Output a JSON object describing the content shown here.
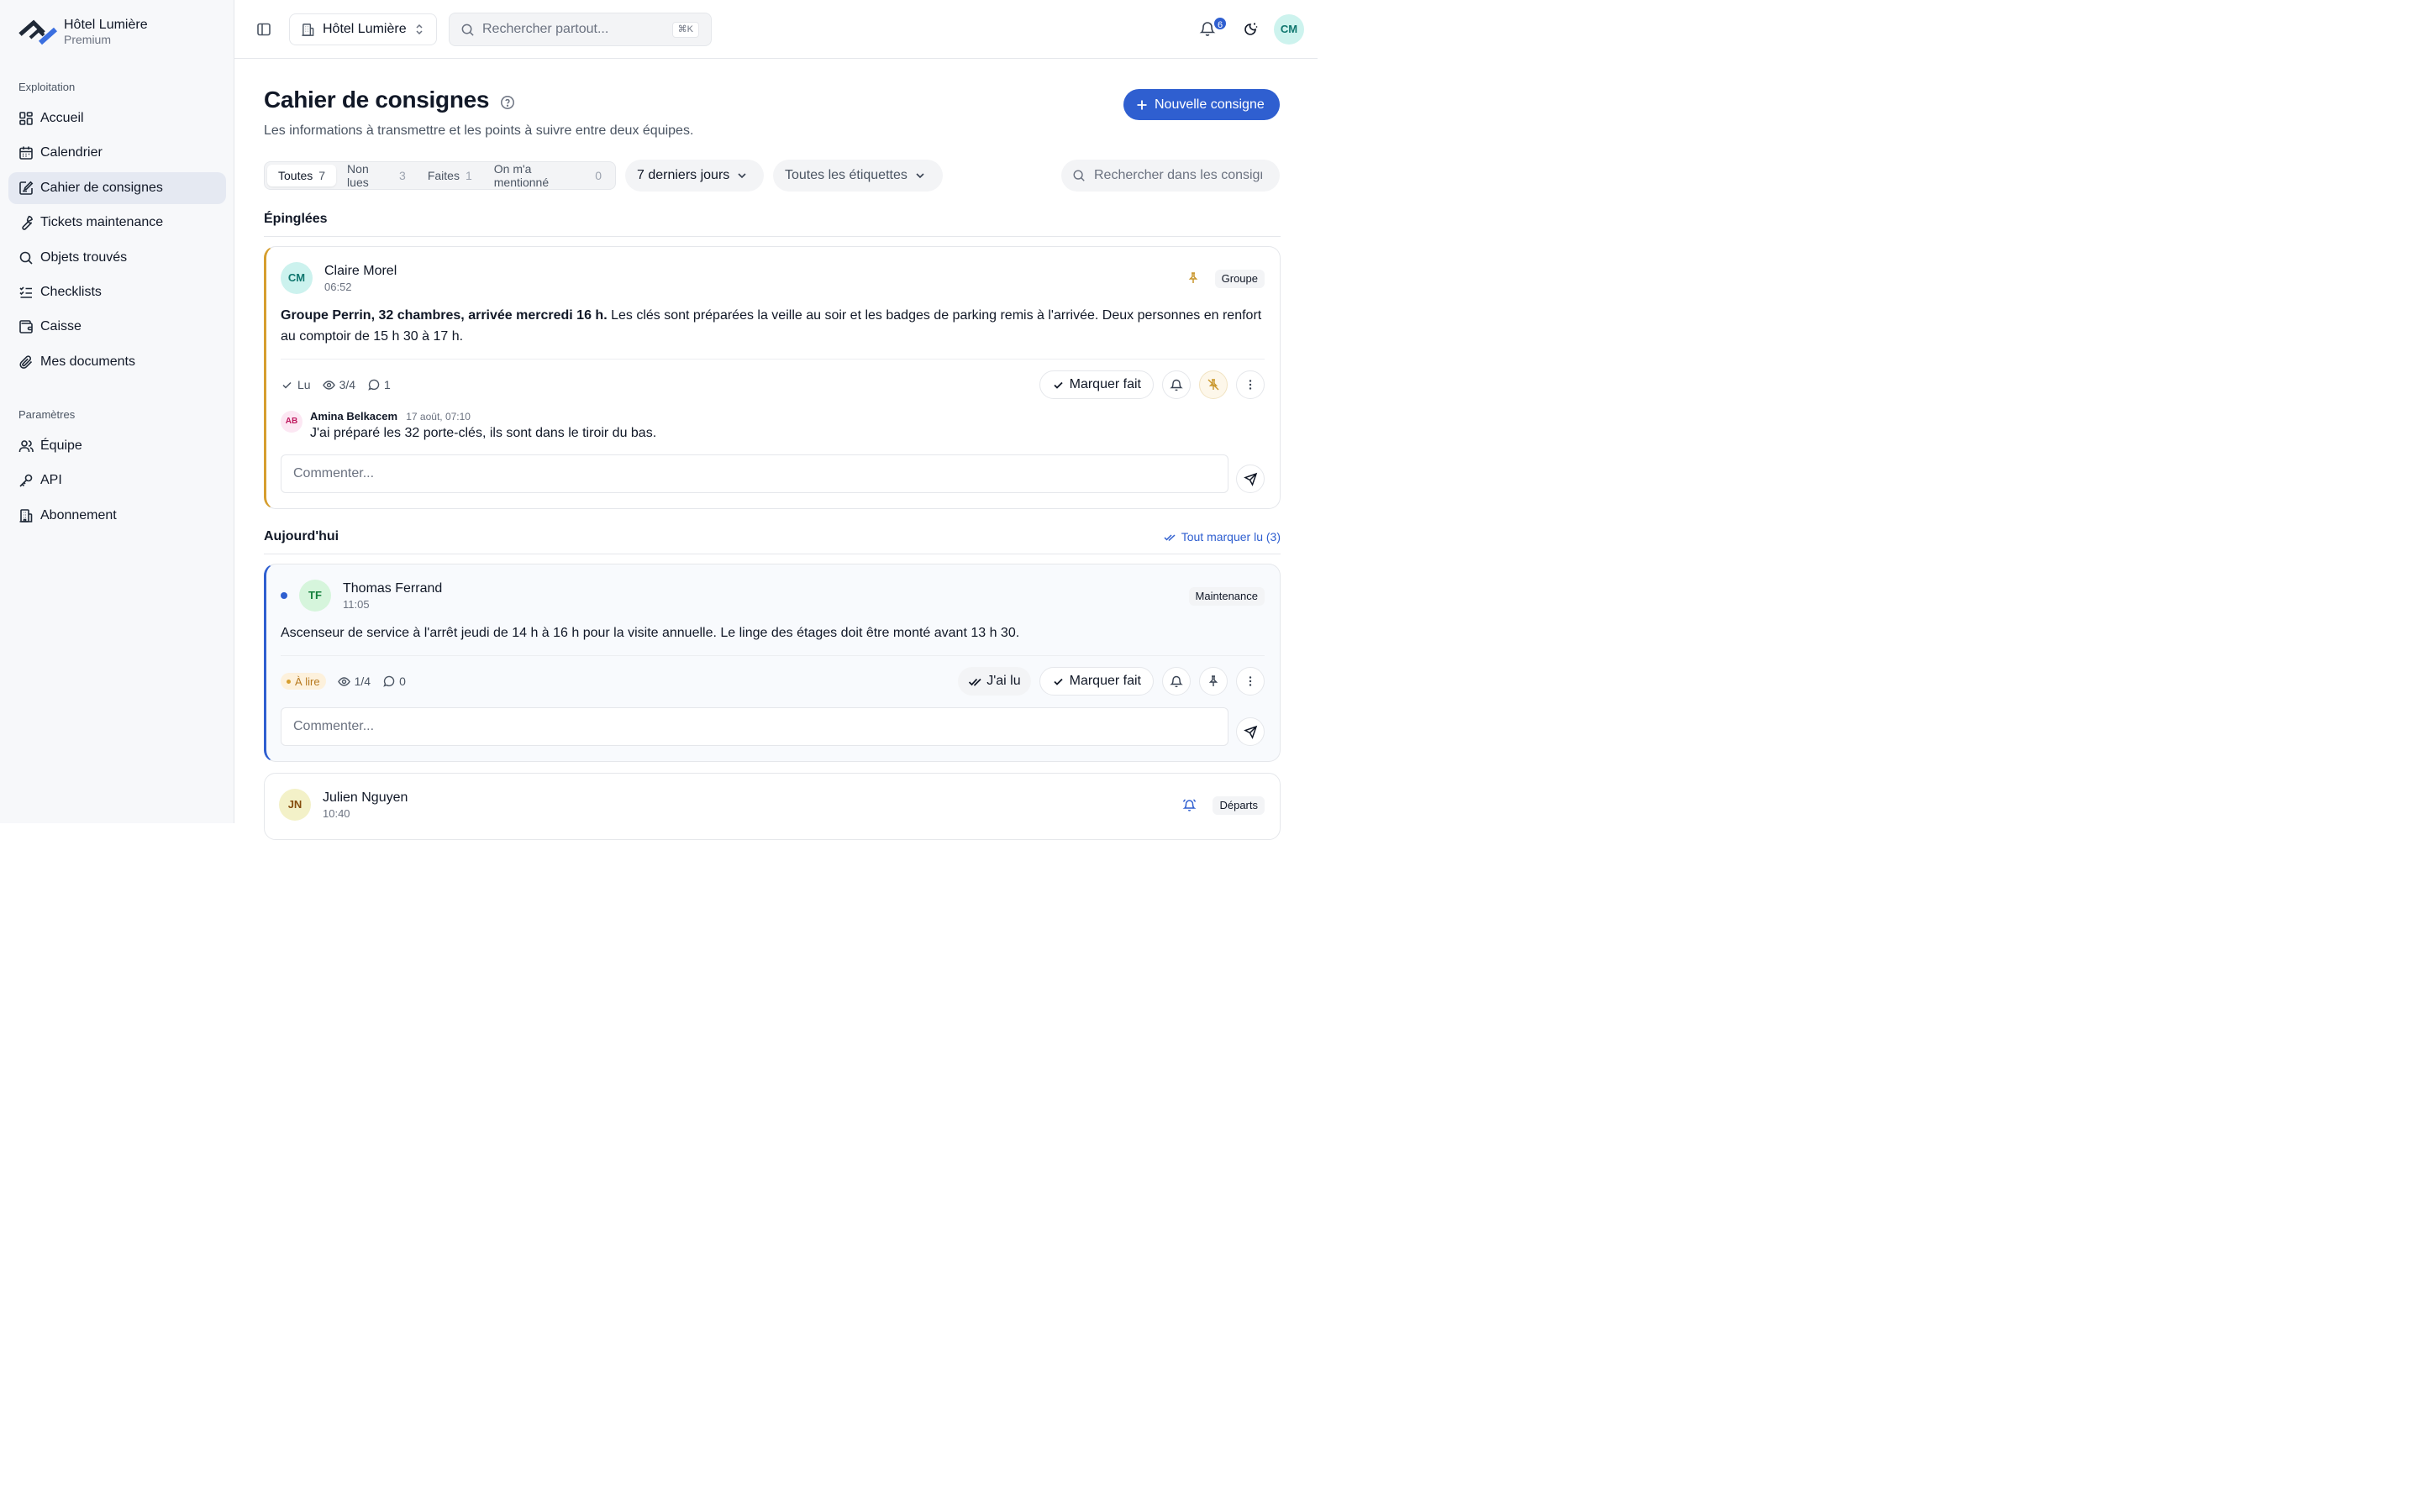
{
  "brand": {
    "name": "Hôtel Lumière",
    "plan": "Premium"
  },
  "sidebar": {
    "section1": "Exploitation",
    "items1": [
      {
        "label": "Accueil",
        "icon": "dashboard-icon"
      },
      {
        "label": "Calendrier",
        "icon": "calendar-icon"
      },
      {
        "label": "Cahier de consignes",
        "icon": "notebook-icon",
        "active": true
      },
      {
        "label": "Tickets maintenance",
        "icon": "wrench-icon"
      },
      {
        "label": "Objets trouvés",
        "icon": "search-icon"
      },
      {
        "label": "Checklists",
        "icon": "checklist-icon"
      },
      {
        "label": "Caisse",
        "icon": "wallet-icon"
      },
      {
        "label": "Mes documents",
        "icon": "paperclip-icon"
      }
    ],
    "section2": "Paramètres",
    "items2": [
      {
        "label": "Équipe",
        "icon": "users-icon"
      },
      {
        "label": "API",
        "icon": "key-icon"
      },
      {
        "label": "Abonnement",
        "icon": "building-icon"
      }
    ]
  },
  "topbar": {
    "hotel": "Hôtel Lumière",
    "search_placeholder": "Rechercher partout...",
    "shortcut": "⌘K",
    "notifications": "6",
    "user_initials": "CM"
  },
  "page": {
    "title": "Cahier de consignes",
    "subtitle": "Les informations à transmettre et les points à suivre entre deux équipes.",
    "new_button": "Nouvelle consigne"
  },
  "filters": {
    "tabs": [
      {
        "label": "Toutes",
        "count": "7",
        "active": true
      },
      {
        "label": "Non lues",
        "count": "3"
      },
      {
        "label": "Faites",
        "count": "1"
      },
      {
        "label": "On m'a mentionné",
        "count": "0"
      }
    ],
    "period": "7 derniers jours",
    "tags": "Toutes les étiquettes",
    "search_placeholder": "Rechercher dans les consignes"
  },
  "sections": {
    "pinned": "Épinglées",
    "today": "Aujourd'hui",
    "mark_all": "Tout marquer lu (3)"
  },
  "cards": [
    {
      "initials": "CM",
      "author": "Claire Morel",
      "time": "06:52",
      "tag": "Groupe",
      "body_bold": "Groupe Perrin, 32 chambres, arrivée mercredi 16 h.",
      "body": " Les clés sont préparées la veille au soir et les badges de parking remis à l'arrivée. Deux personnes en renfort au comptoir de 15 h 30 à 17 h.",
      "status": "Lu",
      "views": "3/4",
      "comments": "1",
      "done_label": "Marquer fait",
      "comment": {
        "initials": "AB",
        "author": "Amina Belkacem",
        "time": "17 août, 07:10",
        "text": "J'ai préparé les 32 porte-clés, ils sont dans le tiroir du bas."
      },
      "comment_placeholder": "Commenter..."
    },
    {
      "initials": "TF",
      "author": "Thomas Ferrand",
      "time": "11:05",
      "tag": "Maintenance",
      "body": "Ascenseur de service à l'arrêt jeudi de 14 h à 16 h pour la visite annuelle. Le linge des étages doit être monté avant 13 h 30.",
      "status": "À lire",
      "views": "1/4",
      "comments": "0",
      "read_label": "J'ai lu",
      "done_label": "Marquer fait",
      "comment_placeholder": "Commenter..."
    },
    {
      "initials": "JN",
      "author": "Julien Nguyen",
      "time": "10:40",
      "tag": "Départs"
    }
  ]
}
